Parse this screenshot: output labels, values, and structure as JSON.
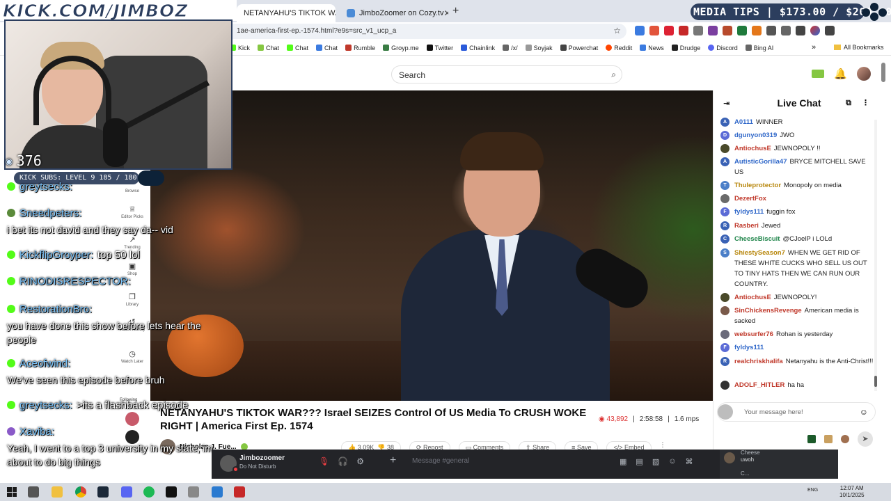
{
  "browser": {
    "tabs": [
      {
        "title": "NETANYAHU'S TIKTOK WAR???",
        "active": true
      },
      {
        "title": "JimboZoomer on Cozy.tv",
        "active": false
      }
    ],
    "url": "1ae-america-first-ep.-1574.html?e9s=src_v1_ucp_a",
    "bookmarks": [
      "Kick",
      "Chat",
      "Chat",
      "Chat",
      "Rumble",
      "Groyp.me",
      "Twitter",
      "Chainlink",
      "/x/",
      "Soyjak",
      "Powerchat",
      "Reddit",
      "News",
      "Drudge",
      "Discord",
      "Bing AI"
    ],
    "all_bookmarks": "All Bookmarks"
  },
  "site": {
    "search_placeholder": "Search",
    "sidebar": [
      {
        "label": "Browse",
        "icon": "compass-icon"
      },
      {
        "label": "Editor Picks",
        "icon": "award-icon"
      },
      {
        "label": "Trending",
        "icon": "trending-icon"
      },
      {
        "label": "Shop",
        "icon": "shop-icon"
      },
      {
        "label": "Library",
        "icon": "library-icon"
      },
      {
        "label": "Watch History",
        "icon": "history-icon"
      },
      {
        "label": "Watch Later",
        "icon": "clock-icon"
      }
    ],
    "following_label": "Following"
  },
  "video": {
    "title": "NETANYAHU'S TIKTOK WAR??? Israel SEIZES Control Of US Media To CRUSH WOKE RIGHT | America First Ep. 1574",
    "views": "43,892",
    "duration": "2:58:58",
    "bitrate": "1.6 mps",
    "channel": "Nicholas J. Fue...",
    "likes": "3.09K",
    "dislikes": "38",
    "actions": [
      "Repost",
      "Comments",
      "Share",
      "Save",
      "Embed"
    ]
  },
  "live_chat": {
    "title": "Live Chat",
    "messages": [
      {
        "user": "A0111",
        "text": "WINNER",
        "color": "#2f67c9",
        "badge": "A",
        "avatar_color": "#3a62b5"
      },
      {
        "user": "dgunyon0319",
        "text": "JWO",
        "color": "#2f67c9",
        "badge": "D",
        "avatar_color": "#5b6bd6"
      },
      {
        "user": "AntiochusE",
        "text": "JEWNOPOLY !!",
        "color": "#c0392b",
        "badge": "",
        "avatar_color": "#4a4a2a"
      },
      {
        "user": "AutisticGorilla47",
        "text": "BRYCE MITCHELL SAVE US",
        "color": "#2f67c9",
        "badge": "A",
        "avatar_color": "#3a62b5"
      },
      {
        "user": "Thuleprotector",
        "text": "Monopoly on media",
        "color": "#b7860b",
        "badge": "T",
        "avatar_color": "#4b7fc8"
      },
      {
        "user": "DezertFox",
        "text": "",
        "color": "#c0392b",
        "badge": "",
        "avatar_color": "#6a6a6a"
      },
      {
        "user": "fyldys111",
        "text": "fuggin fox",
        "color": "#2f67c9",
        "badge": "F",
        "avatar_color": "#5b6bd6"
      },
      {
        "user": "Rasberi",
        "text": "Jewed",
        "color": "#c0392b",
        "badge": "R",
        "avatar_color": "#3a62b5"
      },
      {
        "user": "CheeseBiscuit",
        "text": "@CJoelP i LOLd",
        "color": "#1e8449",
        "badge": "C",
        "avatar_color": "#3a62b5"
      },
      {
        "user": "ShiestySeason7",
        "text": "WHEN WE GET RID OF THESE WHITE CUCKS WHO SELL US OUT TO TINY HATS THEN WE CAN RUN OUR COUNTRY.",
        "color": "#b7860b",
        "badge": "S",
        "avatar_color": "#4b7fc8"
      },
      {
        "user": "AntiochusE",
        "text": "JEWNOPOLY!",
        "color": "#c0392b",
        "badge": "",
        "avatar_color": "#4a4a2a"
      },
      {
        "user": "SinChickensRevenge",
        "text": "American media is sacked",
        "color": "#c0392b",
        "badge": "",
        "avatar_color": "#7a5a4a"
      },
      {
        "user": "websurfer76",
        "text": "Rohan is yesterday",
        "color": "#c0392b",
        "badge": "",
        "avatar_color": "#6a6a7a"
      },
      {
        "user": "fyldys111",
        "text": "",
        "color": "#2f67c9",
        "badge": "F",
        "avatar_color": "#5b6bd6"
      },
      {
        "user": "realchriskhalifa",
        "text": "Netanyahu is the Anti-Christ!!!",
        "color": "#c0392b",
        "badge": "R",
        "avatar_color": "#3a62b5"
      },
      {
        "user": "ADOLF_HITLER",
        "text": "ha ha",
        "color": "#c0392b",
        "badge": "",
        "avatar_color": "#333333"
      }
    ],
    "input_placeholder": "Your message here!"
  },
  "overlay": {
    "kick_url": "KICK.COM/JIMBOZ",
    "viewers": "376",
    "subs": "KICK SUBS: LEVEL 9 185 / 180",
    "media_tips": "MEDIA TIPS | $173.00 / $200.00",
    "chat": [
      {
        "user": "greytsecks:",
        "body": "",
        "color": "#7ec8ff"
      },
      {
        "user": "Sneedpeters:",
        "body": "i bet its not david and they say da-- vid",
        "color": "#7ec8ff"
      },
      {
        "user": "KickflipGroyper:",
        "body": "top 50 lol",
        "color": "#7ec8ff"
      },
      {
        "user": "RINODISRESPECTOR:",
        "body": "",
        "color": "#7ec8ff"
      },
      {
        "user": "RestorationBro:",
        "body": "you have done this show before lets hear the people",
        "color": "#7ec8ff"
      },
      {
        "user": "Aceofwind:",
        "body": "We've seen this episode before bruh",
        "color": "#7ec8ff"
      },
      {
        "user": "greytsecks:",
        "body": ">its a flashback episode",
        "color": "#7ec8ff"
      },
      {
        "user": "Xaviba:",
        "body": "Yeah, I went to a top 3 university in my state, im about to do big things",
        "color": "#7ec8ff"
      }
    ]
  },
  "discord": {
    "username": "Jimbozoomer",
    "status": "Do Not Disturb",
    "message_placeholder": "Message #general",
    "side_user": "Cheese",
    "side_sub": "uwoh",
    "side_user2": "C..."
  },
  "taskbar": {
    "lang": "ENG",
    "time": "12:07 AM",
    "date": "10/1/2025"
  }
}
